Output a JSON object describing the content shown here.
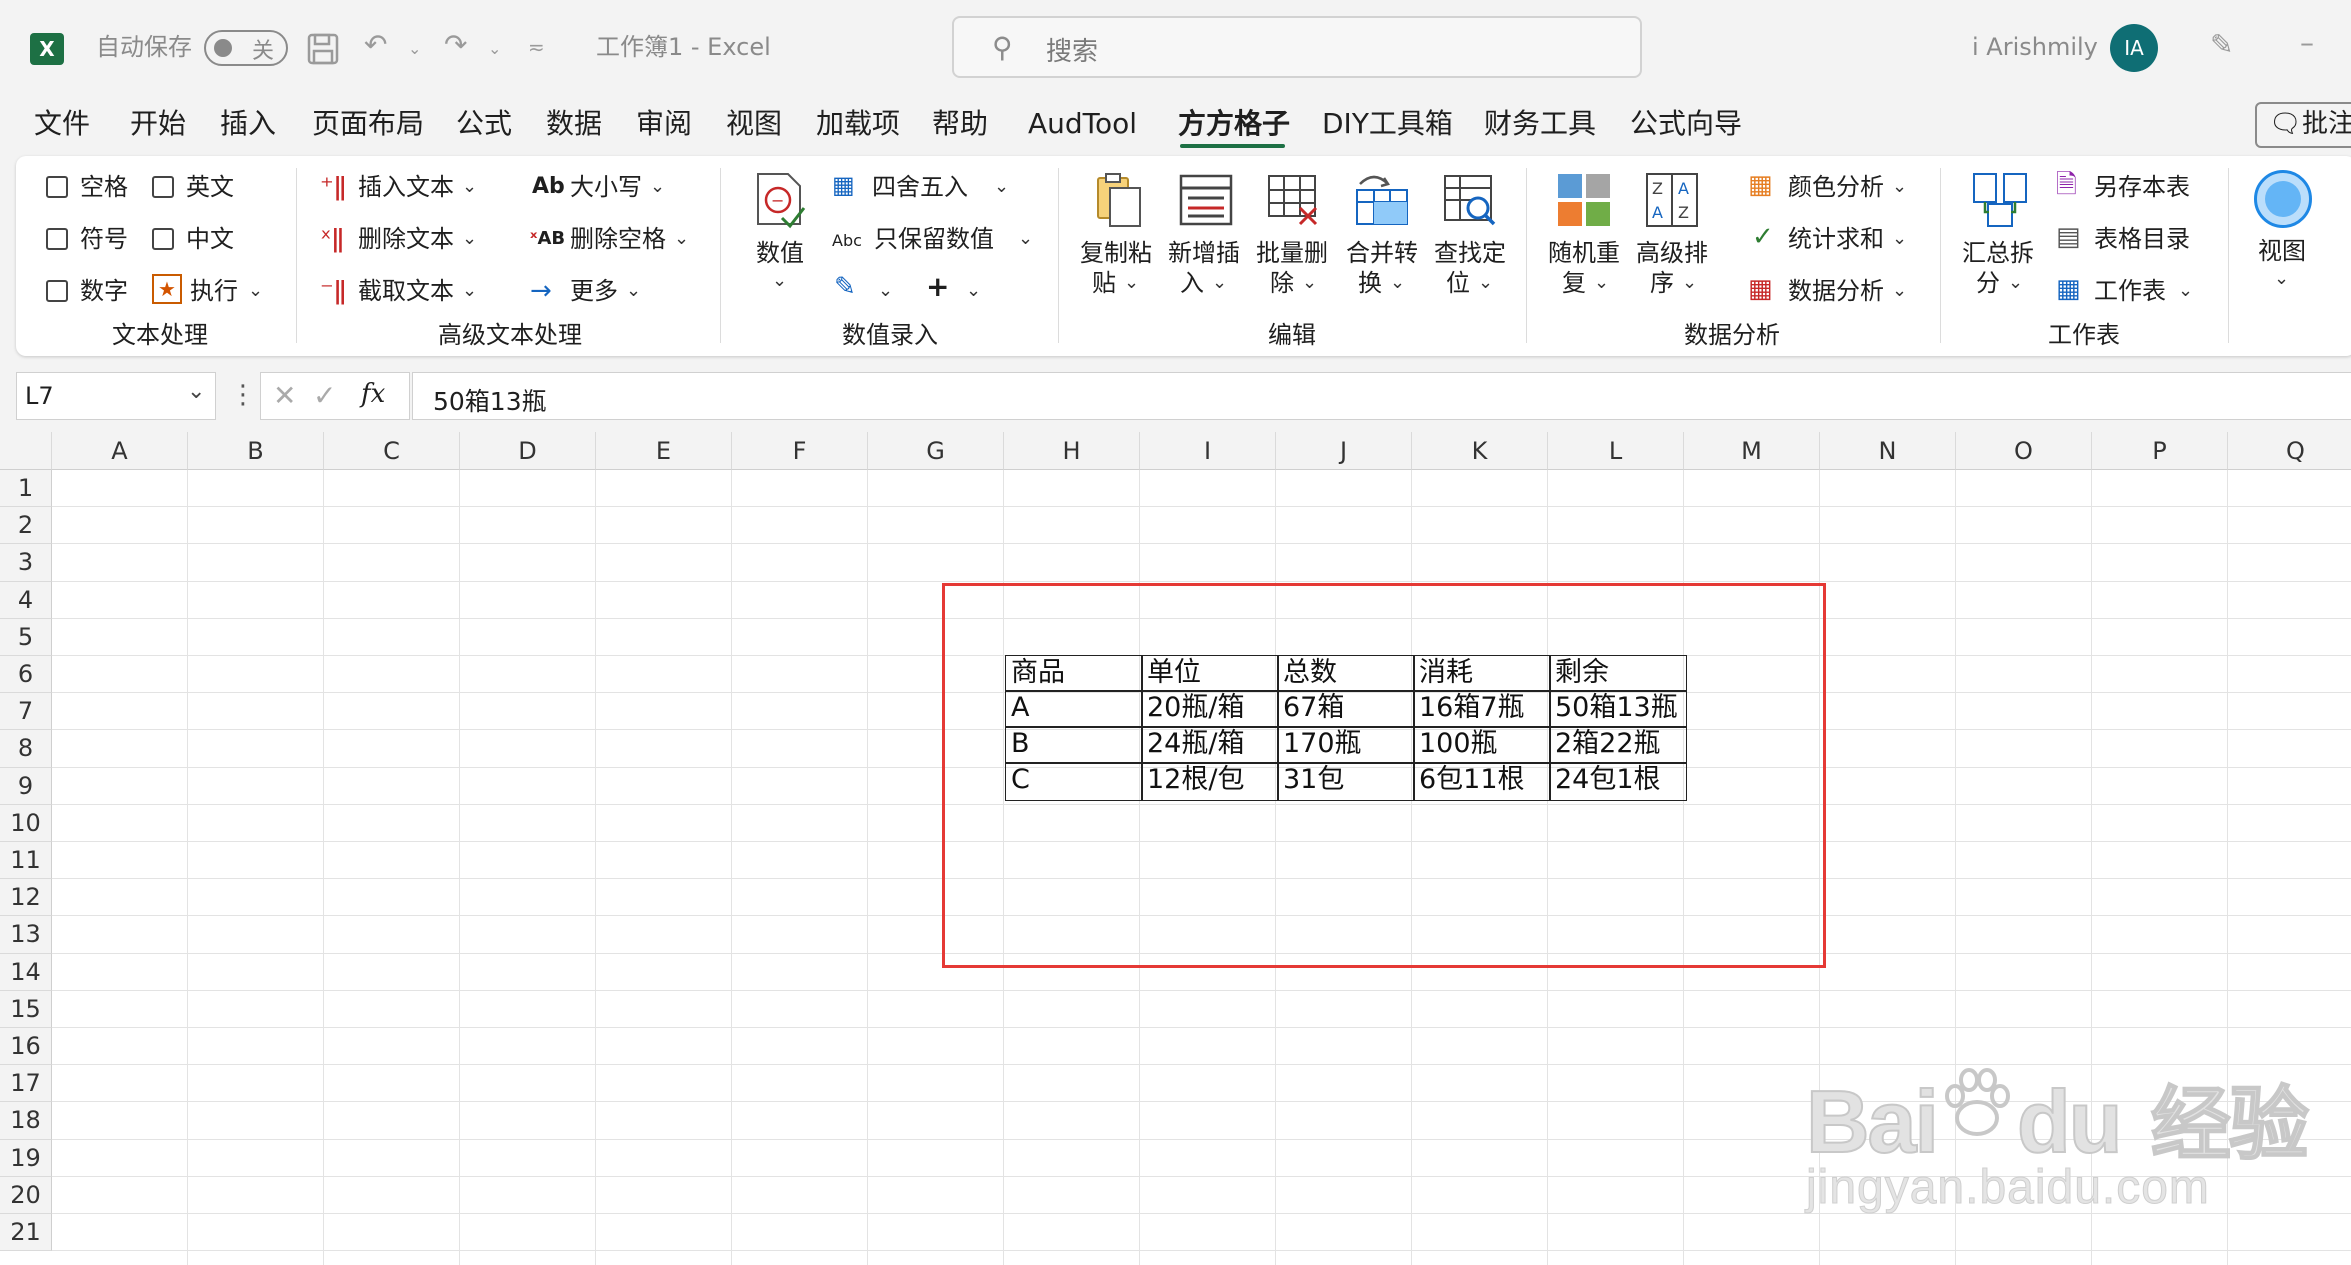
{
  "titlebar": {
    "autosave_label": "自动保存",
    "autosave_state": "关",
    "doc_title": "工作簿1  -  Excel",
    "search_placeholder": "搜索",
    "user_name": "i Arishmily",
    "user_initials": "IA",
    "app_icon": "X"
  },
  "menu": {
    "tabs": [
      "文件",
      "开始",
      "插入",
      "页面布局",
      "公式",
      "数据",
      "审阅",
      "视图",
      "加载项",
      "帮助",
      "AudTool",
      "方方格子",
      "DIY工具箱",
      "财务工具",
      "公式向导"
    ],
    "active_tab": "方方格子",
    "comment_label": "批注"
  },
  "ribbon": {
    "text_processing": {
      "label": "文本处理",
      "checks": [
        "空格",
        "英文",
        "符号",
        "中文",
        "数字"
      ],
      "execute": "执行"
    },
    "advanced_text": {
      "label": "高级文本处理",
      "items": [
        "插入文本",
        "删除文本",
        "截取文本",
        "大小写",
        "删除空格",
        "更多"
      ]
    },
    "number_entry": {
      "label": "数值录入",
      "big": "数值",
      "items": [
        "四舍五入",
        "只保留数值"
      ]
    },
    "edit": {
      "label": "编辑",
      "buttons": [
        {
          "l1": "复制粘",
          "l2": "贴"
        },
        {
          "l1": "新增插",
          "l2": "入"
        },
        {
          "l1": "批量删",
          "l2": "除"
        },
        {
          "l1": "合并转",
          "l2": "换"
        },
        {
          "l1": "查找定",
          "l2": "位"
        }
      ]
    },
    "data_analysis": {
      "label": "数据分析",
      "buttons": [
        {
          "l1": "随机重",
          "l2": "复"
        },
        {
          "l1": "高级排",
          "l2": "序"
        }
      ],
      "items": [
        "颜色分析",
        "统计求和",
        "数据分析"
      ]
    },
    "worksheet": {
      "label": "工作表",
      "big": {
        "l1": "汇总拆",
        "l2": "分"
      },
      "items": [
        "另存本表",
        "表格目录",
        "工作表"
      ]
    },
    "view": {
      "label": "视图"
    }
  },
  "formula_bar": {
    "name_box": "L7",
    "fx": "fx",
    "content": "50箱13瓶"
  },
  "grid": {
    "columns": [
      "A",
      "B",
      "C",
      "D",
      "E",
      "F",
      "G",
      "H",
      "I",
      "J",
      "K",
      "L",
      "M",
      "N",
      "O",
      "P",
      "Q"
    ],
    "rows": [
      "1",
      "2",
      "3",
      "4",
      "5",
      "6",
      "7",
      "8",
      "9",
      "10",
      "11",
      "12",
      "13",
      "14",
      "15",
      "16",
      "17",
      "18",
      "19",
      "20",
      "21"
    ]
  },
  "table": {
    "header": [
      "商品",
      "单位",
      "总数",
      "消耗",
      "剩余"
    ],
    "rows": [
      [
        "A",
        "20瓶/箱",
        "67箱",
        "16箱7瓶",
        "50箱13瓶"
      ],
      [
        "B",
        "24瓶/箱",
        "170瓶",
        "100瓶",
        "2箱22瓶"
      ],
      [
        "C",
        "12根/包",
        "31包",
        "6包11根",
        "24包1根"
      ]
    ]
  },
  "watermark": {
    "brand": "Bai",
    "brand2": "du",
    "cn": "经验",
    "url": "jingyan.baidu.com"
  },
  "colors": {
    "excel_green": "#1d7044",
    "selection_red": "#e53935",
    "avatar": "#0f6e74"
  }
}
